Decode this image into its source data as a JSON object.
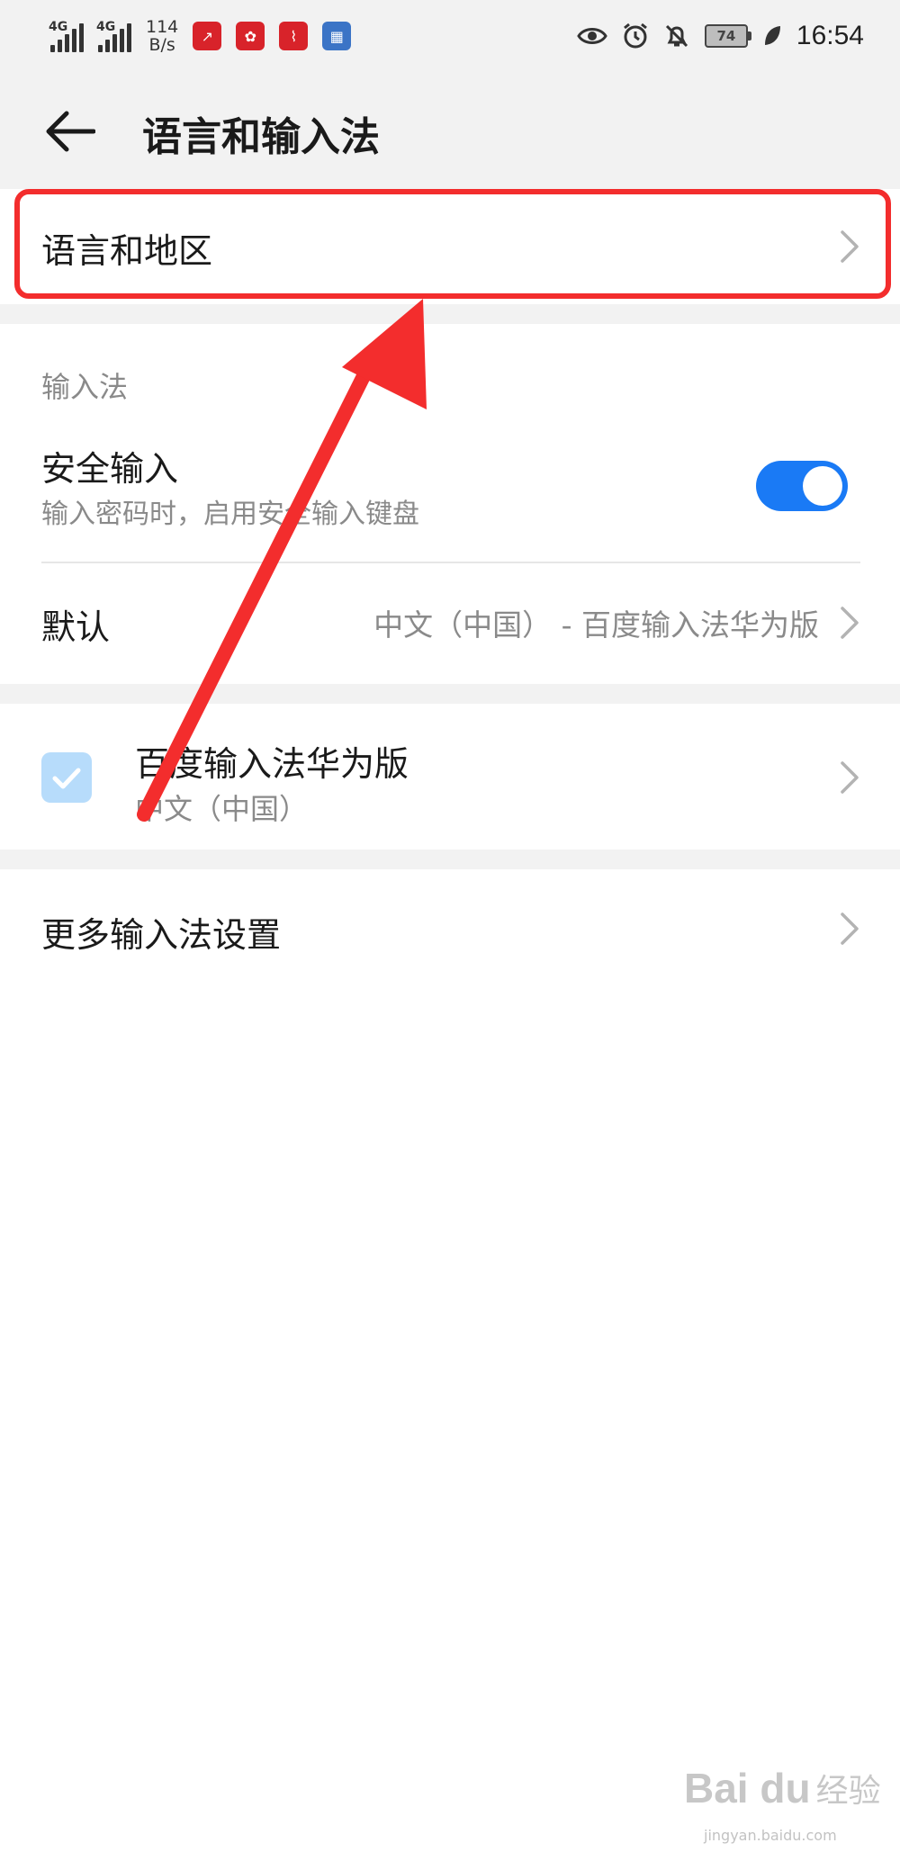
{
  "status_bar": {
    "network_left": "4G",
    "network_right": "4G",
    "speed_value": "114",
    "speed_unit": "B/s",
    "battery": "74",
    "time": "16:54"
  },
  "header": {
    "title": "语言和输入法"
  },
  "language_region": {
    "label": "语言和地区"
  },
  "input_methods": {
    "section_label": "输入法",
    "secure_input": {
      "title": "安全输入",
      "subtitle": "输入密码时，启用安全输入键盘",
      "enabled": true
    },
    "default": {
      "title": "默认",
      "value": "中文（中国） - 百度输入法华为版"
    }
  },
  "keyboard": {
    "name": "百度输入法华为版",
    "language": "中文（中国）",
    "checked": true
  },
  "more_settings": {
    "label": "更多输入法设置"
  },
  "watermark": {
    "logo": "Bai du",
    "cn": "经验",
    "sub": "jingyan.baidu.com"
  },
  "colors": {
    "accent": "#1a7af5",
    "annotation": "#f32d2d",
    "background": "#f2f2f2"
  }
}
